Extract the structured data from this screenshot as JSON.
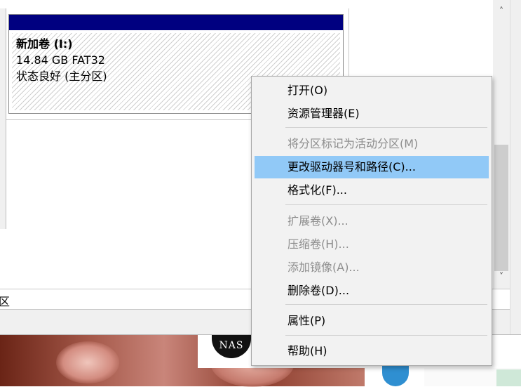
{
  "partition": {
    "name": "新加卷  (I:)",
    "size": "14.84 GB FAT32",
    "status": "状态良好 (主分区)"
  },
  "legend": {
    "text": "区"
  },
  "background": {
    "nas_logo": "NAS"
  },
  "scrollbar": {
    "up_icon": "chevron-up",
    "down_icon": "chevron-down"
  },
  "context_menu": {
    "items": [
      {
        "label": "打开(O)",
        "enabled": true
      },
      {
        "label": "资源管理器(E)",
        "enabled": true
      },
      {
        "label": "将分区标记为活动分区(M)",
        "enabled": false
      },
      {
        "label": "更改驱动器号和路径(C)...",
        "enabled": true,
        "highlighted": true
      },
      {
        "label": "格式化(F)...",
        "enabled": true
      },
      {
        "label": "扩展卷(X)...",
        "enabled": false
      },
      {
        "label": "压缩卷(H)...",
        "enabled": false
      },
      {
        "label": "添加镜像(A)...",
        "enabled": false
      },
      {
        "label": "删除卷(D)...",
        "enabled": true
      },
      {
        "label": "属性(P)",
        "enabled": true
      },
      {
        "label": "帮助(H)",
        "enabled": true
      }
    ]
  },
  "colors": {
    "partition_header": "#000080",
    "menu_highlight": "#91c9f7",
    "disabled_text": "#8d8d8d"
  }
}
